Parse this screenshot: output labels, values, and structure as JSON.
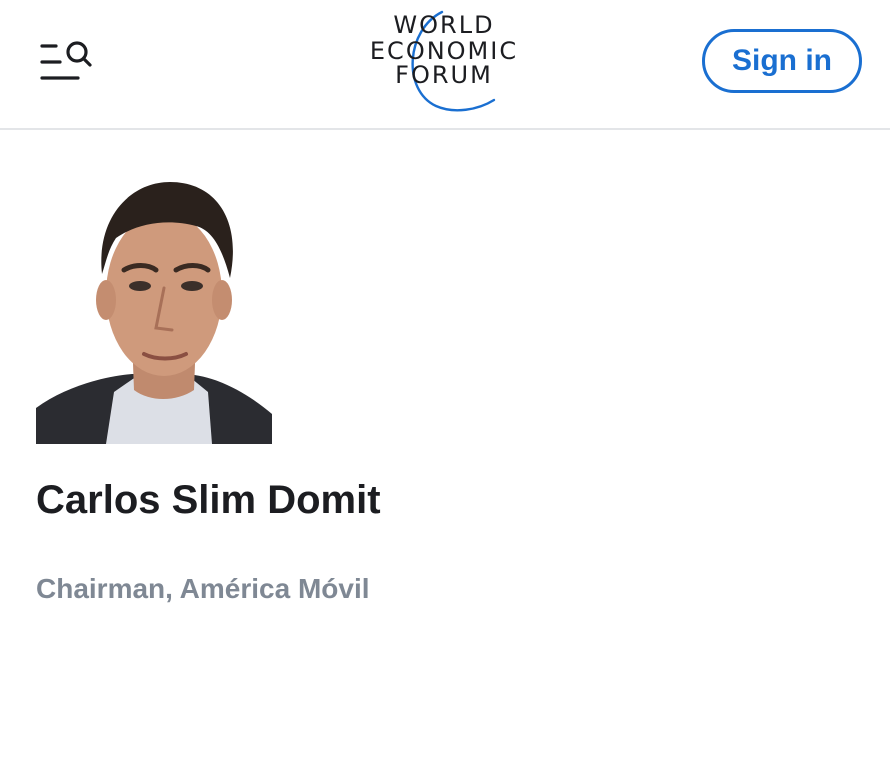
{
  "header": {
    "logo": {
      "line1": "WORLD",
      "line2": "ECONOMIC",
      "line3": "FORUM"
    },
    "menu_icon": "menu-search-icon",
    "signin_label": "Sign in"
  },
  "profile": {
    "name": "Carlos Slim Domit",
    "role": "Chairman, América Móvil"
  },
  "colors": {
    "accent": "#1a6fd1",
    "role_text": "#7f8894",
    "divider": "#e3e5e8"
  }
}
